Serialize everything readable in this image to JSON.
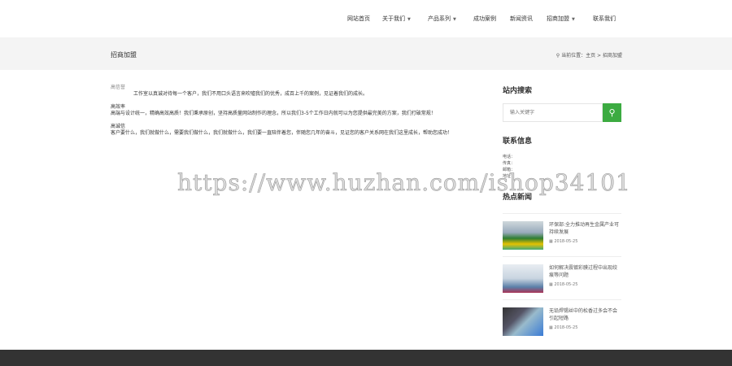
{
  "nav": {
    "items": [
      "网站首页",
      "关于我们",
      "产品系列",
      "成功案例",
      "新闻资讯",
      "招商加盟",
      "联系我们"
    ]
  },
  "banner": {
    "title": "招商加盟",
    "crumb_label": "当前位置：",
    "crumb_home": "主页",
    "crumb_sep": ">",
    "crumb_current": "招商加盟"
  },
  "main": {
    "heading0": "高信誉",
    "para0": "工作室以真诚对待每一个客户，我们不用口头语言来吹嘘我们的优秀，成百上千的案例，见证着我们的成长。",
    "heading1": "高效率",
    "para1": "高端与设计统一，精确高效高质！我们秉承原创，坚持高质量网站制作的理念，所以我们3-5个工作日内就可以为您提供最完美的方案，我们打破常规！",
    "heading2": "高诚信",
    "para2": "客户要什么，我们就做什么，需要我们做什么，我们就做什么，我们要一直陪伴着您，伴随您几年的奋斗，见证您的客户关系网在我们这里成长，帮助您成功！"
  },
  "sidebar": {
    "search_title": "站内搜索",
    "search_placeholder": "输入关键字",
    "contact_title": "联系信息",
    "contact": [
      "电话：",
      "传真：",
      "邮箱：",
      "地址："
    ],
    "news_title": "热点新闻",
    "news": [
      {
        "title": "环保部:全力推动再生金属产业可持续发展",
        "date": "2018-05-25"
      },
      {
        "title": "如何解决震镀彩膜过程中出现绞痕等问题",
        "date": "2018-05-25"
      },
      {
        "title": "无铅焊锡丝中的松香过多会不会引起短路",
        "date": "2018-05-25"
      }
    ]
  },
  "watermark": "https://www.huzhan.com/ishop34101"
}
